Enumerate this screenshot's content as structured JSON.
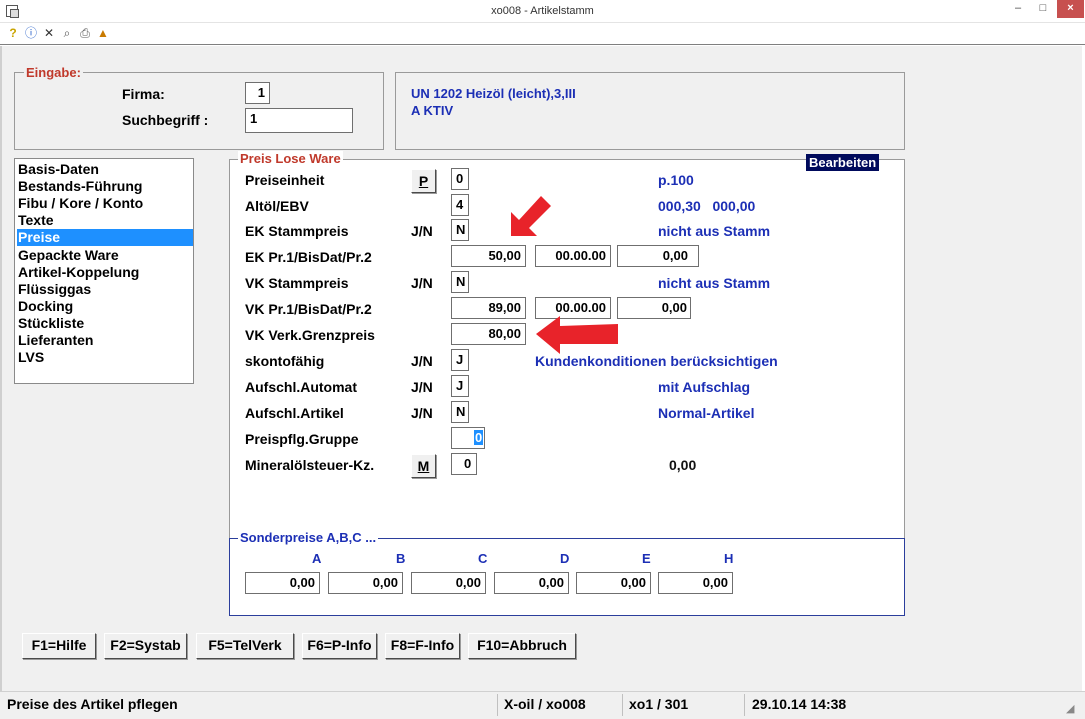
{
  "window": {
    "title": "xo008 - Artikelstamm",
    "min": "–",
    "max": "□",
    "close": "×"
  },
  "toolbar": {
    "icons": [
      "help-icon",
      "info-icon",
      "delete-icon",
      "search-icon",
      "print-icon",
      "export-icon"
    ]
  },
  "eingabe": {
    "legend": "Eingabe:",
    "firma_label": "Firma:",
    "firma_value": "1",
    "such_label": "Suchbegriff :",
    "such_value": "1",
    "desc_line1": "UN 1202 Heizöl (leicht),3,III",
    "desc_line2": "A  KTIV"
  },
  "nav": {
    "items": [
      "Basis-Daten",
      "Bestands-Führung",
      "Fibu / Kore / Konto",
      "Texte",
      "Preise",
      "Gepackte Ware",
      "Artikel-Koppelung",
      "Flüssiggas",
      "Docking",
      "Stückliste",
      "Lieferanten",
      "LVS"
    ],
    "selected": "Preise"
  },
  "preis": {
    "legend": "Preis Lose Ware",
    "bearbeiten": "Bearbeiten",
    "p_button": "P",
    "m_button": "M",
    "rows": [
      {
        "label": "Preiseinheit",
        "jn": "",
        "code": "0",
        "info": "p.100"
      },
      {
        "label": "Altöl/EBV",
        "jn": "",
        "code": "4",
        "info": "000,30   000,00"
      },
      {
        "label": "EK Stammpreis",
        "jn": "J/N",
        "code": "N",
        "info": "nicht aus Stamm"
      },
      {
        "label": "EK Pr.1/BisDat/Pr.2",
        "price": "50,00",
        "date": "00.00.00",
        "price2": "0,00"
      },
      {
        "label": "VK Stammpreis",
        "jn": "J/N",
        "code": "N",
        "info": "nicht aus Stamm"
      },
      {
        "label": "VK Pr.1/BisDat/Pr.2",
        "price": "89,00",
        "date": "00.00.00",
        "price2": "0,00"
      },
      {
        "label": "VK Verk.Grenzpreis",
        "price": "80,00"
      },
      {
        "label": "skontofähig",
        "jn": "J/N",
        "code": "J",
        "info": "Kundenkonditionen berücksichtigen"
      },
      {
        "label": "Aufschl.Automat",
        "jn": "J/N",
        "code": "J",
        "info": "mit Aufschlag"
      },
      {
        "label": "Aufschl.Artikel",
        "jn": "J/N",
        "code": "N",
        "info": "Normal-Artikel"
      },
      {
        "label": "Preispflg.Gruppe",
        "code": "0"
      },
      {
        "label": "Mineralölsteuer-Kz.",
        "code": "0",
        "info": "0,00"
      }
    ]
  },
  "sonder": {
    "legend": "Sonderpreise A,B,C ...",
    "headers": [
      "A",
      "B",
      "C",
      "D",
      "E",
      "H"
    ],
    "values": [
      "0,00",
      "0,00",
      "0,00",
      "0,00",
      "0,00",
      "0,00"
    ]
  },
  "fkeys": [
    "F1=Hilfe",
    "F2=Systab",
    "F5=TelVerk",
    "F6=P-Info",
    "F8=F-Info",
    "F10=Abbruch"
  ],
  "status": {
    "text": "Preise des Artikel pflegen",
    "system": "X-oil / xo008",
    "user": "xo1 / 301",
    "datetime": "29.10.14 14:38"
  },
  "colors": {
    "accent_blue": "#1c2fb5",
    "legend_red": "#c0392b",
    "selected": "#1e90ff",
    "arrow": "#e8232a"
  }
}
